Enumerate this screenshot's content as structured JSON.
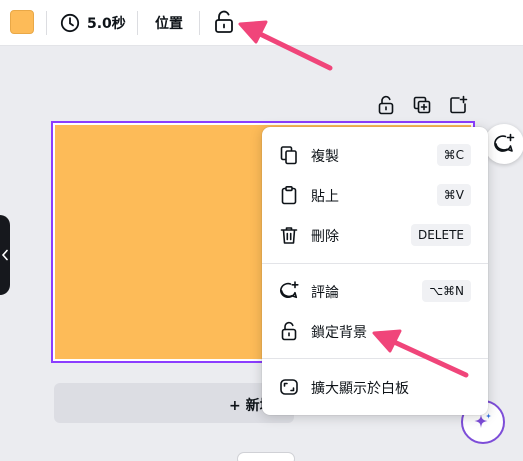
{
  "colors": {
    "page_fill": "#fdbb58",
    "selection": "#8b3dff",
    "annotation_arrow": "#f0457a"
  },
  "toolbar": {
    "color_swatch_icon": "color-swatch",
    "duration_icon": "clock-icon",
    "duration_label": "5.0秒",
    "position_label": "位置",
    "lock_icon": "lock-open-icon"
  },
  "canvas_toolbar": {
    "icons": [
      "lock-open-icon",
      "duplicate-page-icon",
      "add-page-icon"
    ]
  },
  "context_menu": {
    "items": [
      {
        "icon": "copy-icon",
        "label": "複製",
        "shortcut": "⌘C"
      },
      {
        "icon": "clipboard-icon",
        "label": "貼上",
        "shortcut": "⌘V"
      },
      {
        "icon": "trash-icon",
        "label": "刪除",
        "shortcut": "DELETE"
      },
      {
        "icon": "comment-add-icon",
        "label": "評論",
        "shortcut": "⌥⌘N"
      },
      {
        "icon": "lock-open-icon",
        "label": "鎖定背景",
        "shortcut": ""
      },
      {
        "icon": "expand-icon",
        "label": "擴大顯示於白板",
        "shortcut": ""
      }
    ]
  },
  "add_page": {
    "label": "+ 新增"
  },
  "fab": {
    "comment_icon": "comment-add-icon",
    "magic_icon": "sparkle-icon"
  }
}
